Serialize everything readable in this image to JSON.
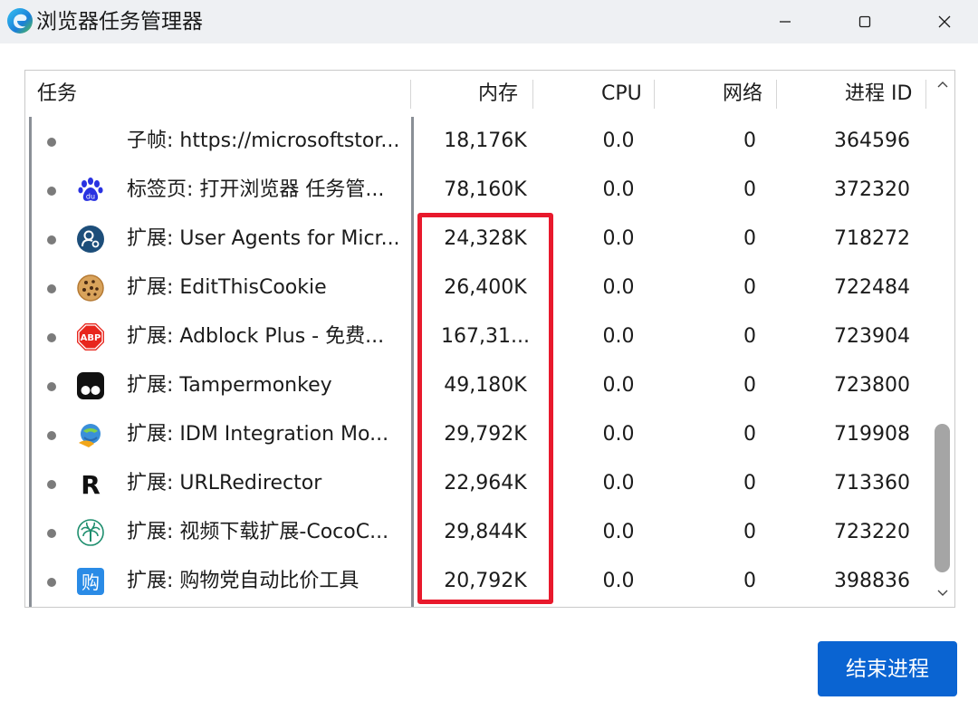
{
  "window": {
    "title": "浏览器任务管理器"
  },
  "columns": {
    "task": "任务",
    "memory": "内存",
    "cpu": "CPU",
    "network": "网络",
    "pid": "进程 ID"
  },
  "rows": [
    {
      "icon": "none",
      "name": "子帧: https://microsoftstor...",
      "memory": "18,176K",
      "cpu": "0.0",
      "network": "0",
      "pid": "364596"
    },
    {
      "icon": "baidu-icon",
      "name": "标签页: 打开浏览器 任务管...",
      "memory": "78,160K",
      "cpu": "0.0",
      "network": "0",
      "pid": "372320"
    },
    {
      "icon": "user-agent-icon",
      "name": "扩展: User Agents for Micr...",
      "memory": "24,328K",
      "cpu": "0.0",
      "network": "0",
      "pid": "718272"
    },
    {
      "icon": "cookie-icon",
      "name": "扩展: EditThisCookie",
      "memory": "26,400K",
      "cpu": "0.0",
      "network": "0",
      "pid": "722484"
    },
    {
      "icon": "adblock-icon",
      "name": "扩展: Adblock Plus - 免费...",
      "memory": "167,31...",
      "cpu": "0.0",
      "network": "0",
      "pid": "723904"
    },
    {
      "icon": "tampermonkey-icon",
      "name": "扩展: Tampermonkey",
      "memory": "49,180K",
      "cpu": "0.0",
      "network": "0",
      "pid": "723800"
    },
    {
      "icon": "idm-icon",
      "name": "扩展: IDM Integration Mo...",
      "memory": "29,792K",
      "cpu": "0.0",
      "network": "0",
      "pid": "719908"
    },
    {
      "icon": "urlredirector-icon",
      "name": "扩展: URLRedirector",
      "memory": "22,964K",
      "cpu": "0.0",
      "network": "0",
      "pid": "713360"
    },
    {
      "icon": "palm-tree-icon",
      "name": "扩展: 视频下载扩展-CocoC...",
      "memory": "29,844K",
      "cpu": "0.0",
      "network": "0",
      "pid": "723220"
    },
    {
      "icon": "shopping-icon",
      "name": "扩展: 购物党自动比价工具",
      "memory": "20,792K",
      "cpu": "0.0",
      "network": "0",
      "pid": "398836"
    }
  ],
  "icons": {
    "adblock_text": "ABP",
    "urlredirector_text": "R",
    "shopping_text": "购",
    "baidu_text": "du"
  },
  "buttons": {
    "end_process": "结束进程"
  },
  "colors": {
    "accent": "#0a64d2",
    "highlight": "#e8192c"
  }
}
